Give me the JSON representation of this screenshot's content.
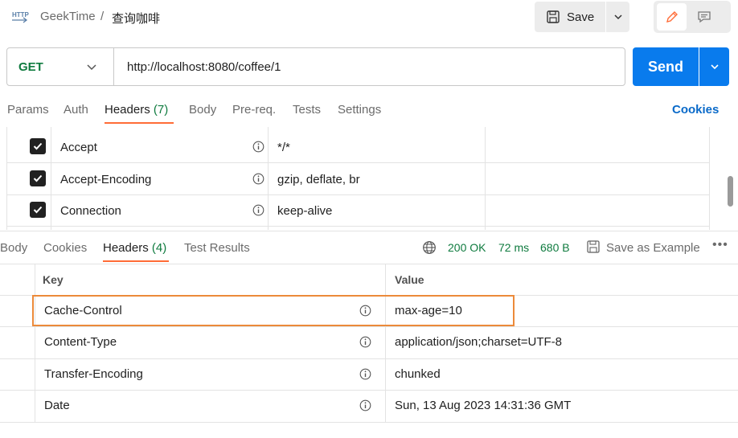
{
  "breadcrumb": {
    "icon": "http-icon",
    "icon_text": "HTTP",
    "workspace": "GeekTime",
    "separator": "/",
    "request_name": "查询咖啡"
  },
  "toolbar": {
    "save_label": "Save"
  },
  "url_bar": {
    "method": "GET",
    "url": "http://localhost:8080/coffee/1",
    "send_label": "Send"
  },
  "request_tabs": [
    {
      "label": "Params"
    },
    {
      "label": "Auth"
    },
    {
      "label": "Headers",
      "count": "(7)",
      "active": true
    },
    {
      "label": "Body"
    },
    {
      "label": "Pre-req."
    },
    {
      "label": "Tests"
    },
    {
      "label": "Settings"
    }
  ],
  "cookies_link": "Cookies",
  "request_headers": [
    {
      "checked": true,
      "key": "Accept",
      "value": "*/*"
    },
    {
      "checked": true,
      "key": "Accept-Encoding",
      "value": "gzip, deflate, br"
    },
    {
      "checked": true,
      "key": "Connection",
      "value": "keep-alive"
    }
  ],
  "response_tabs": [
    {
      "label": "Body"
    },
    {
      "label": "Cookies"
    },
    {
      "label": "Headers",
      "count": "(4)",
      "active": true
    },
    {
      "label": "Test Results"
    }
  ],
  "response_meta": {
    "status": "200 OK",
    "time": "72 ms",
    "size": "680 B",
    "save_example": "Save as Example",
    "more": "•••"
  },
  "response_table": {
    "headers": {
      "key": "Key",
      "value": "Value"
    },
    "rows": [
      {
        "key": "Cache-Control",
        "value": "max-age=10",
        "highlighted": true
      },
      {
        "key": "Content-Type",
        "value": "application/json;charset=UTF-8"
      },
      {
        "key": "Transfer-Encoding",
        "value": "chunked"
      },
      {
        "key": "Date",
        "value": "Sun, 13 Aug 2023 14:31:36 GMT"
      }
    ]
  },
  "colors": {
    "accent": "#ff6c37",
    "send": "#097bed",
    "method": "#0f7b3f",
    "status": "#0f7b3f",
    "highlight_border": "#ec8a3a",
    "link": "#0a6ac9"
  }
}
